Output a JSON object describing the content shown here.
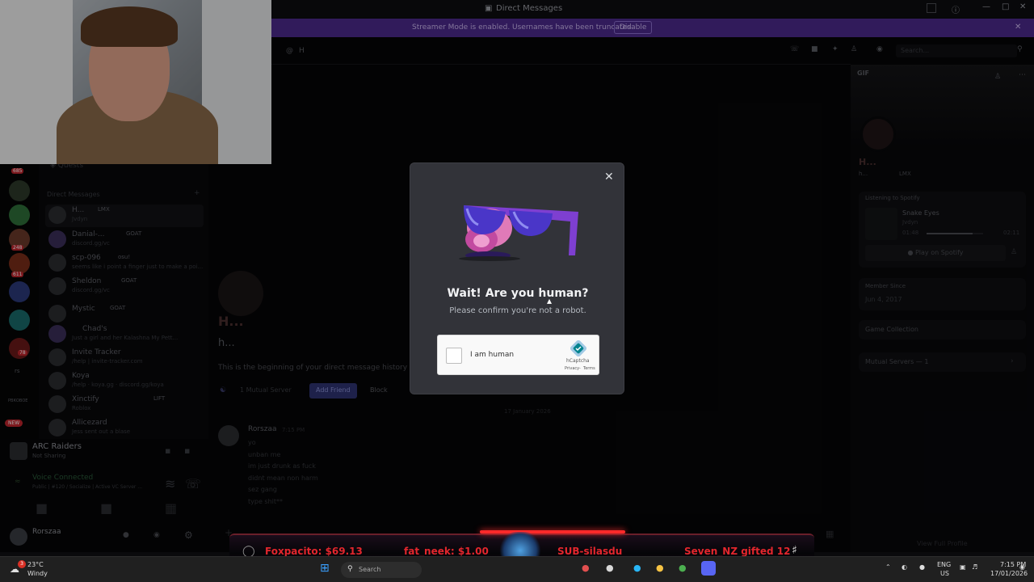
{
  "titlebar": {
    "title": "Direct Messages"
  },
  "banner": {
    "text": "Streamer Mode is enabled. Usernames have been truncated.",
    "disable_label": "Disable"
  },
  "chat_header": {
    "name": "H",
    "search_placeholder": "Search"
  },
  "sidebar": {
    "quests_label": "Quests",
    "dm_header": "Direct Messages",
    "items": [
      {
        "name": "H...",
        "tag": "LMX",
        "status": "Jvdyn"
      },
      {
        "name": "Danial-...",
        "tag": "GOAT",
        "status": "discord.gg/vc"
      },
      {
        "name": "scp-096",
        "tag": "osu!",
        "status": "seems like i point a finger just to make a poi..."
      },
      {
        "name": "Sheldon",
        "tag": "GOAT",
        "status": "discord.gg/vc"
      },
      {
        "name": "Mystic",
        "tag": "GOAT",
        "status": ""
      },
      {
        "name": "Chad's",
        "tag": "",
        "status": "Just a girl and her Kalashna My Pett..."
      },
      {
        "name": "Invite Tracker",
        "tag": "",
        "status": "/help | invite-tracker.com"
      },
      {
        "name": "Koya",
        "tag": "",
        "status": "/help · koya.gg · discord.gg/koya"
      },
      {
        "name": "Xinctify",
        "tag": "LIFT",
        "status": "Roblox"
      },
      {
        "name": "Allicezard",
        "tag": "",
        "status": "Jess sent out a blase"
      }
    ],
    "badges": [
      "685",
      "248",
      "611",
      "78",
      "NEW"
    ],
    "rs_label": "rs",
    "rs_sub": "РВКОВОЕ"
  },
  "activity": {
    "game": "ARC Raiders",
    "sub": "Not Sharing"
  },
  "voice": {
    "status": "Voice Connected",
    "channel": "Public | #120 / Socialize | Active VC Server ..."
  },
  "user_panel": {
    "name": "Rorszaa"
  },
  "chat": {
    "intro_name": "H...",
    "intro_handle": "h...",
    "intro_text": "This is the beginning of your direct message history with",
    "mutual": "1 Mutual Server",
    "add_friend": "Add Friend",
    "block": "Block",
    "date_divider": "17 January 2026",
    "message": {
      "author": "Rorszaa",
      "time": "7:15 PM",
      "lines": [
        "yo",
        "unban me",
        "im just drunk as fuck",
        "didnt mean non harm",
        "sez gang",
        "type shit**"
      ]
    }
  },
  "profile": {
    "gif_label": "GIF",
    "name": "H...",
    "handle": "h...",
    "tag": "LMX",
    "spotify_header": "Listening to Spotify",
    "track": "Snake Eyes",
    "artist": "Jvdyn",
    "time_elapsed": "01:48",
    "time_total": "02:11",
    "progress": 0.82,
    "play_button": "Play on Spotify",
    "member_since_label": "Member Since",
    "member_since": "Jun 4, 2017",
    "game_collection": "Game Collection",
    "mutual_servers": "Mutual Servers — 1",
    "view_full": "View Full Profile"
  },
  "modal": {
    "title": "Wait! Are you human?",
    "subtitle": "Please confirm you're not a robot.",
    "checkbox_label": "I am human",
    "brand": "hCaptcha",
    "privacy": "Privacy",
    "terms": "Terms"
  },
  "ticker": {
    "items": [
      "Foxpacito: $69.13",
      "fat_neek: $1.00",
      "SUB-silasdu",
      "Seven_NZ gifted 12"
    ]
  },
  "taskbar": {
    "temp": "23°C",
    "weather": "Windy",
    "search_placeholder": "Search",
    "lang": "ENG",
    "region": "US",
    "time": "7:15 PM",
    "date": "17/01/2026"
  },
  "colors": {
    "accent": "#5865f2",
    "banner": "#4c2a8c",
    "ticker_red": "#e3262d",
    "spotify": "#1db954"
  }
}
